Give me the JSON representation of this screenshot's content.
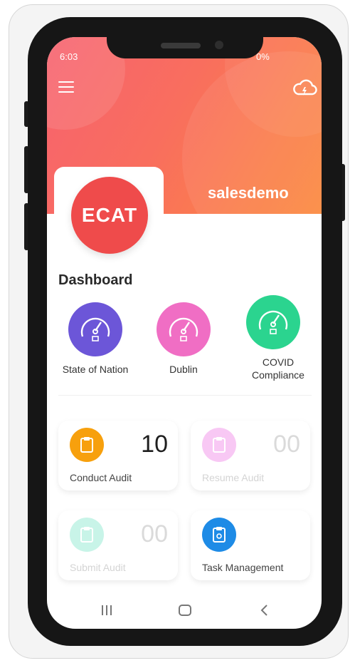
{
  "status_bar": {
    "time": "6:03",
    "right_text": "0%"
  },
  "header": {
    "username": "salesdemo",
    "logo_text": "ECAT"
  },
  "dashboard": {
    "title": "Dashboard",
    "gauges": [
      {
        "label": "State of Nation",
        "color": "#6c56d8"
      },
      {
        "label": "Dublin",
        "color": "#f06ec4"
      },
      {
        "label_line1": "COVID",
        "label_line2": "Compliance",
        "color": "#2bd48f"
      }
    ]
  },
  "cards": [
    {
      "label": "Conduct Audit",
      "count": "10",
      "icon": "clipboard-icon",
      "color": "#f7a00d"
    },
    {
      "label": "Resume Audit",
      "count": "00",
      "icon": "clipboard-icon",
      "color": "#f8c8f4"
    },
    {
      "label": "Submit Audit",
      "count": "00",
      "icon": "clipboard-icon",
      "color": "#c8f4e8"
    },
    {
      "label": "Task Management",
      "icon": "task-clipboard-icon",
      "color": "#1e8be6"
    }
  ],
  "nav": [
    "recent-apps-icon",
    "home-icon",
    "back-icon"
  ]
}
